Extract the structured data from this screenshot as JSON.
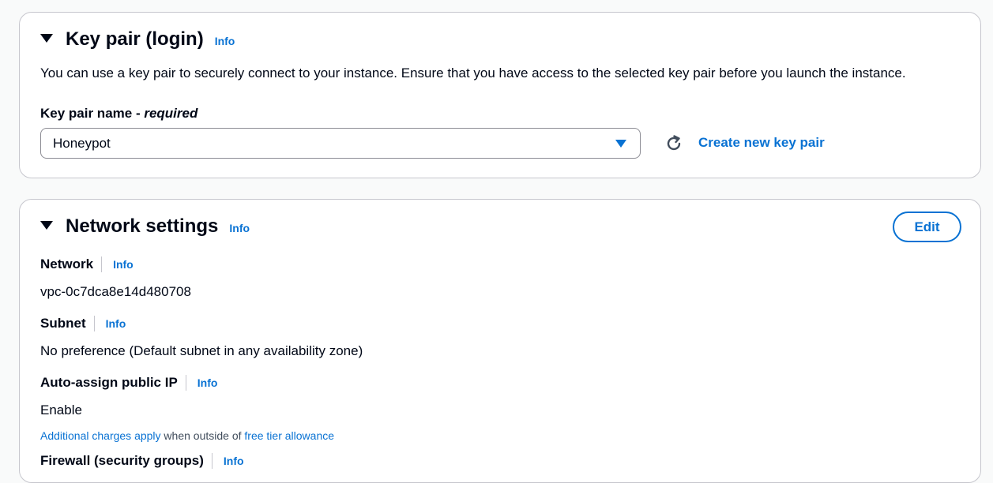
{
  "key_pair": {
    "title": "Key pair (login)",
    "info": "Info",
    "description": "You can use a key pair to securely connect to your instance. Ensure that you have access to the selected key pair before you launch the instance.",
    "field_label": "Key pair name - ",
    "field_required": "required",
    "selected_value": "Honeypot",
    "create_link": "Create new key pair"
  },
  "network": {
    "title": "Network settings",
    "info": "Info",
    "edit_label": "Edit",
    "network_label": "Network",
    "network_info": "Info",
    "network_value": "vpc-0c7dca8e14d480708",
    "subnet_label": "Subnet",
    "subnet_info": "Info",
    "subnet_value": "No preference (Default subnet in any availability zone)",
    "public_ip_label": "Auto-assign public IP",
    "public_ip_info": "Info",
    "public_ip_value": "Enable",
    "charges_link": "Additional charges apply",
    "charges_mid": " when outside of ",
    "free_tier_link": "free tier allowance",
    "firewall_label": "Firewall (security groups)",
    "firewall_info": "Info"
  },
  "colors": {
    "link": "#0972d3",
    "text": "#000716",
    "border": "#c6c6cd"
  },
  "icons": [
    "caret-down-icon",
    "dropdown-arrow-icon",
    "refresh-icon"
  ]
}
